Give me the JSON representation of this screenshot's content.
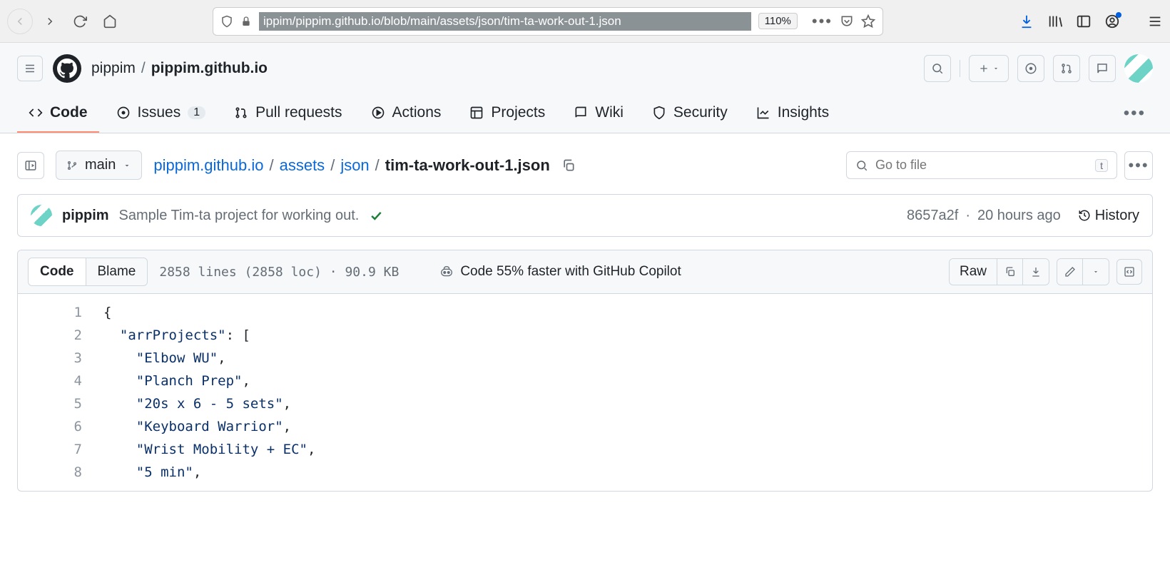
{
  "browser": {
    "url": "ippim/pippim.github.io/blob/main/assets/json/tim-ta-work-out-1.json",
    "zoom": "110%"
  },
  "repo": {
    "owner": "pippim",
    "name": "pippim.github.io"
  },
  "tabs": {
    "code": "Code",
    "issues": "Issues",
    "issues_count": "1",
    "pulls": "Pull requests",
    "actions": "Actions",
    "projects": "Projects",
    "wiki": "Wiki",
    "security": "Security",
    "insights": "Insights"
  },
  "branch": "main",
  "path": {
    "repo": "pippim.github.io",
    "seg1": "assets",
    "seg2": "json",
    "file": "tim-ta-work-out-1.json"
  },
  "search": {
    "placeholder": "Go to file",
    "kbd": "t"
  },
  "commit": {
    "author": "pippim",
    "msg": "Sample Tim-ta project for working out.",
    "sha": "8657a2f",
    "time": "20 hours ago",
    "history": "History"
  },
  "file": {
    "tab_code": "Code",
    "tab_blame": "Blame",
    "stats_lines": "2858 lines (2858 loc)",
    "stats_size": "90.9 KB",
    "copilot": "Code 55% faster with GitHub Copilot",
    "raw": "Raw"
  },
  "code_lines": [
    {
      "n": "1",
      "indent": 0,
      "text": "{",
      "type": "pun"
    },
    {
      "n": "2",
      "indent": 1,
      "text": "\"arrProjects\": [",
      "type": "keybracket"
    },
    {
      "n": "3",
      "indent": 2,
      "text": "\"Elbow WU\",",
      "type": "str"
    },
    {
      "n": "4",
      "indent": 2,
      "text": "\"Planch Prep\",",
      "type": "str"
    },
    {
      "n": "5",
      "indent": 2,
      "text": "\"20s x 6 - 5 sets\",",
      "type": "str"
    },
    {
      "n": "6",
      "indent": 2,
      "text": "\"Keyboard Warrior\",",
      "type": "str"
    },
    {
      "n": "7",
      "indent": 2,
      "text": "\"Wrist Mobility + EC\",",
      "type": "str"
    },
    {
      "n": "8",
      "indent": 2,
      "text": "\"5 min\",",
      "type": "str"
    }
  ]
}
